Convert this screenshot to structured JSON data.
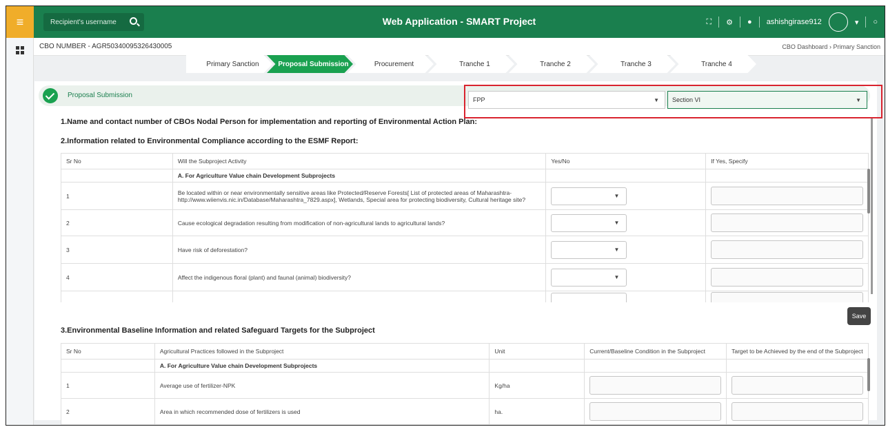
{
  "header": {
    "search_placeholder": "Recipient's username",
    "title": "Web Application - SMART Project",
    "username": "ashishgirase912"
  },
  "subheader": {
    "cbo_number": "CBO NUMBER - AGR50340095326430005",
    "breadcrumb": [
      "CBO Dashboard",
      "Primary Sanction"
    ]
  },
  "steps": [
    {
      "label": "Primary Sanction",
      "active": false
    },
    {
      "label": "Proposal Submission",
      "active": true
    },
    {
      "label": "Procurement",
      "active": false
    },
    {
      "label": "Tranche 1",
      "active": false
    },
    {
      "label": "Tranche 2",
      "active": false
    },
    {
      "label": "Tranche 3",
      "active": false
    },
    {
      "label": "Tranche 4",
      "active": false
    }
  ],
  "section_bar": {
    "label": "Proposal Submission",
    "fpp_value": "FPP",
    "section_value": "Section VI"
  },
  "q1": "1.Name and contact number of CBOs Nodal Person for implementation and reporting of Environmental Action Plan:",
  "q2": "2.Information related to Environmental Compliance according to the ESMF Report:",
  "table1": {
    "headers": [
      "Sr No",
      "Will the Subproject Activity",
      "Yes/No",
      "If Yes, Specify"
    ],
    "group": "A. For Agriculture Value chain Development Subprojects",
    "rows": [
      {
        "sr": "1",
        "text": "Be located within or near environmentally sensitive areas like Protected/Reserve Forests[ List of protected areas of Maharashtra- http://www.wiienvis.nic.in/Database/Maharashtra_7829.aspx], Wetlands, Special area for protecting biodiversity, Cultural heritage site?"
      },
      {
        "sr": "2",
        "text": "Cause ecological degradation resulting from modification of non-agricultural lands to agricultural lands?"
      },
      {
        "sr": "3",
        "text": "Have risk of deforestation?"
      },
      {
        "sr": "4",
        "text": "Affect the indigenous floral (plant) and faunal (animal) biodiversity?"
      }
    ]
  },
  "save_label": "Save",
  "q3": "3.Environmental Baseline Information and related Safeguard Targets for the Subproject",
  "table2": {
    "headers": [
      "Sr No",
      "Agricultural Practices followed in the Subproject",
      "Unit",
      "Current/Baseline Condition in the Subproject",
      "Target to be Achieved by the end of the Subproject"
    ],
    "group": "A. For Agriculture Value chain Development Subprojects",
    "rows": [
      {
        "sr": "1",
        "text": "Average use of fertilizer-NPK",
        "unit": "Kg/ha"
      },
      {
        "sr": "2",
        "text": "Area in which recommended dose of fertilizers is used",
        "unit": "ha."
      }
    ]
  }
}
